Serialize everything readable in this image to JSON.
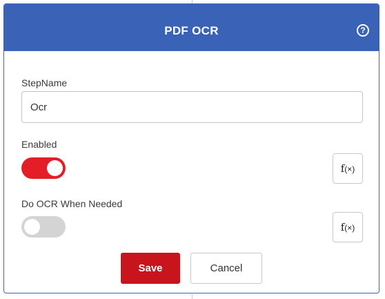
{
  "dialog": {
    "title": "PDF OCR",
    "help_icon": "question-circle-icon",
    "help_glyph": "?"
  },
  "form": {
    "step_name": {
      "label": "StepName",
      "value": "Ocr"
    },
    "enabled": {
      "label": "Enabled",
      "state": true,
      "fx_label": "f",
      "fx_suffix": "(×)"
    },
    "do_ocr_when_needed": {
      "label": "Do OCR When Needed",
      "state": false,
      "fx_label": "f",
      "fx_suffix": "(×)"
    }
  },
  "actions": {
    "save_label": "Save",
    "cancel_label": "Cancel"
  },
  "colors": {
    "header_bg": "#3a63b8",
    "toggle_on": "#e41e26",
    "toggle_off": "#d4d4d4",
    "save_bg": "#c8141c"
  }
}
